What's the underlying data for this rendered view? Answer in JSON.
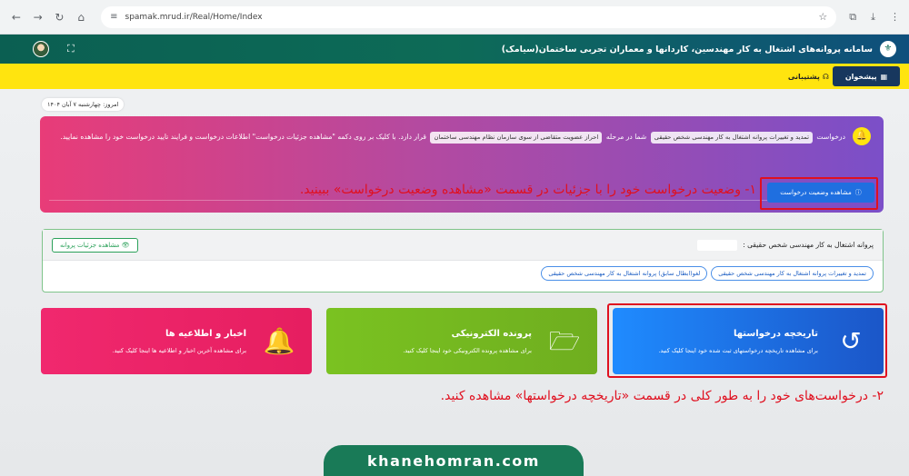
{
  "browser": {
    "url": "spamak.mrud.ir/Real/Home/Index"
  },
  "header": {
    "title": "سامانه پروانه‌های اشتغال به کار مهندسین، کاردانها و معماران تجربی ساختمان(سیامک)"
  },
  "menu": {
    "active_label": "پیشخوان",
    "support_label": "پشتیبانی"
  },
  "date": "امروز: چهارشنبه ۷ آبان ۱۴۰۴",
  "alert": {
    "prefix": "درخواست",
    "chip_request": "تمدید و تغییرات پروانه اشتغال به کار مهندسی شخص حقیقی",
    "middle": "شما در مرحله",
    "chip_stage": "احراز عضویت متقاضی از سوی سازمان نظام مهندسی ساختمان",
    "suffix": "قرار دارد. با کلیک بر روی دکمه \"مشاهده جزئیات درخواست\" اطلاعات درخواست و فرایند تایید درخواست خود را مشاهده نمایید.",
    "status_button": "مشاهده وضعیت درخواست"
  },
  "annotation1": "۱- وضعیت درخواست خود را با جزئیات در قسمت «مشاهده وضعیت درخواست» ببینید.",
  "license": {
    "title": "پروانه اشتغال به کار مهندسی شخص حقیقی :",
    "details_button": "مشاهده جزئیات پروانه",
    "tags": [
      "تمدید و تغییرات پروانه اشتغال به کار مهندسی شخص حقیقی",
      "لغو(ابطال سابق) پروانه اشتغال به کار مهندسی شخص حقیقی"
    ]
  },
  "tiles": {
    "history": {
      "title": "تاریخچه درخواستها",
      "subtitle": "برای مشاهده تاریخچه درخواستهای ثبت شده خود اینجا کلیک کنید."
    },
    "files": {
      "title": "پرونده الکترونیکی",
      "subtitle": "برای مشاهده پرونده الکترونیکی خود اینجا کلیک کنید."
    },
    "news": {
      "title": "اخبار و اطلاعیه ها",
      "subtitle": "برای مشاهده آخرین اخبار و اطلاعیه ها اینجا کلیک کنید."
    }
  },
  "annotation2": "۲- درخواست‌های خود را به طور کلی در قسمت «تاریخچه درخواستها» مشاهده کنید.",
  "brand": "khanehomran.com",
  "colors": {
    "menu_yellow": "#ffe40f",
    "header_green": "#0d6b57",
    "annotation_red": "#e0101f",
    "history_blue": "#1f8bff",
    "files_green": "#7ac221",
    "news_pink": "#f0286e"
  }
}
